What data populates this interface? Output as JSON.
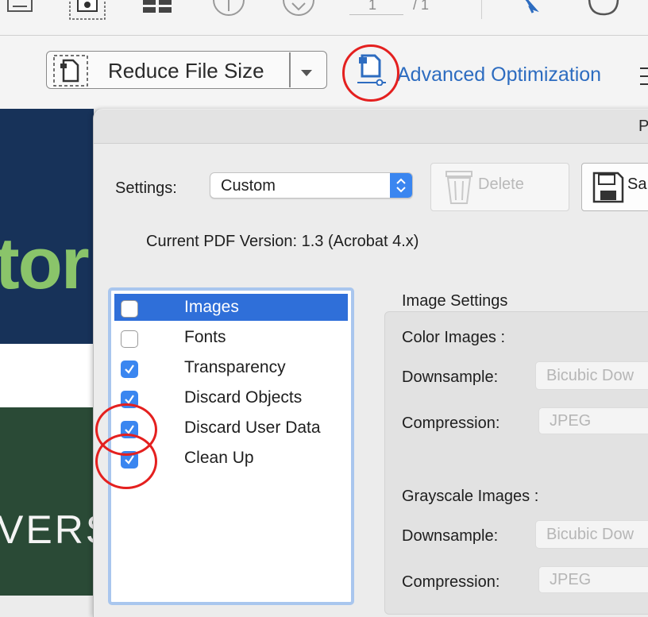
{
  "toolbar": {
    "page_current": "1",
    "page_total": "/ 1"
  },
  "optimize_bar": {
    "preset_label": "Reduce File Size",
    "advanced_label": "Advanced Optimization"
  },
  "background_document": {
    "headline_fragment": "tor",
    "subhead_fragment": "VERS"
  },
  "dialog": {
    "title_fragment": "P",
    "settings_label": "Settings:",
    "settings_value": "Custom",
    "delete_label": "Delete",
    "save_label": "Sa",
    "pdf_version": "Current PDF Version: 1.3 (Acrobat 4.x)",
    "panels": [
      {
        "label": "Images",
        "checked": false,
        "selected": true
      },
      {
        "label": "Fonts",
        "checked": false,
        "selected": false
      },
      {
        "label": "Transparency",
        "checked": true,
        "selected": false
      },
      {
        "label": "Discard Objects",
        "checked": true,
        "selected": false
      },
      {
        "label": "Discard User Data",
        "checked": true,
        "selected": false
      },
      {
        "label": "Clean Up",
        "checked": true,
        "selected": false
      }
    ],
    "image_settings": {
      "title": "Image Settings",
      "color_heading": "Color Images :",
      "color_downsample_label": "Downsample:",
      "color_downsample_value": "Bicubic Dow",
      "color_compression_label": "Compression:",
      "color_compression_value": "JPEG",
      "gray_heading": "Grayscale Images :",
      "gray_downsample_label": "Downsample:",
      "gray_downsample_value": "Bicubic Dow",
      "gray_compression_label": "Compression:",
      "gray_compression_value": "JPEG"
    }
  },
  "colors": {
    "accent_blue": "#3a86f0",
    "selection_blue": "#2f6fd9",
    "link_blue": "#2d6cc0",
    "annotation_red": "#e4201f"
  }
}
